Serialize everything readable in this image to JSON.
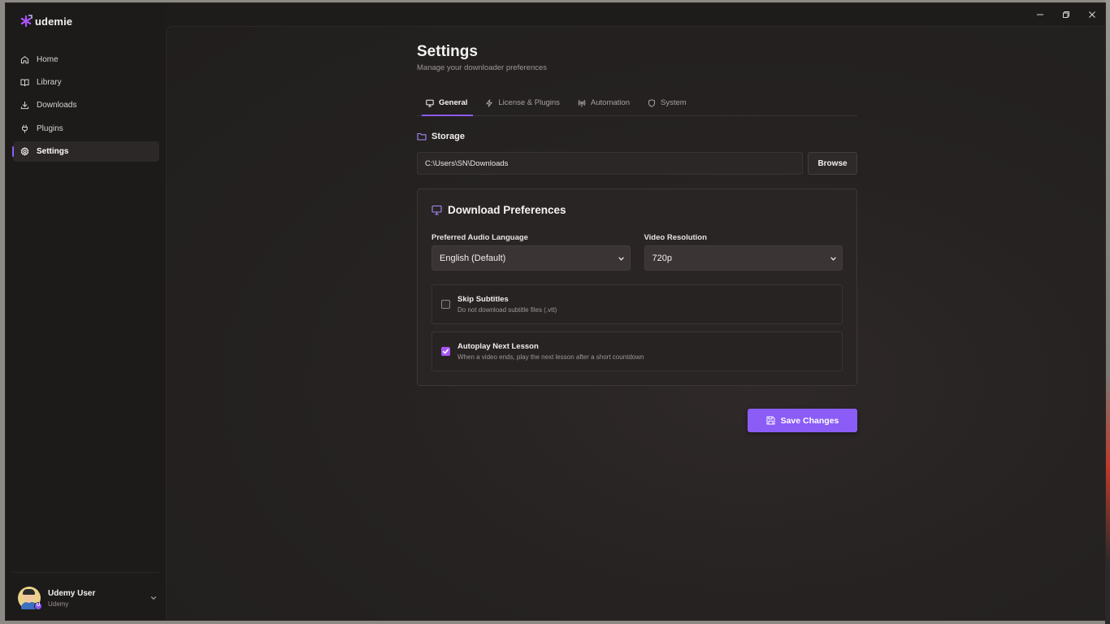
{
  "app": {
    "brand": "udemie"
  },
  "window_controls": {
    "minimize": "─",
    "restore": "❐",
    "close": "✕"
  },
  "sidebar": {
    "items": [
      {
        "label": "Home",
        "icon": "home-icon",
        "active": false
      },
      {
        "label": "Library",
        "icon": "book-icon",
        "active": false
      },
      {
        "label": "Downloads",
        "icon": "download-icon",
        "active": false
      },
      {
        "label": "Plugins",
        "icon": "plug-icon",
        "active": false
      },
      {
        "label": "Settings",
        "icon": "gear-icon",
        "active": true
      }
    ],
    "user": {
      "name": "Udemy User",
      "subtitle": "Udemy",
      "badge": "U"
    }
  },
  "page": {
    "title": "Settings",
    "subtitle": "Manage your downloader preferences"
  },
  "tabs": [
    {
      "label": "General",
      "icon": "monitor-icon",
      "active": true
    },
    {
      "label": "License & Plugins",
      "icon": "zap-icon",
      "active": false
    },
    {
      "label": "Automation",
      "icon": "broadcast-icon",
      "active": false
    },
    {
      "label": "System",
      "icon": "shield-icon",
      "active": false
    }
  ],
  "storage": {
    "heading": "Storage",
    "path": "C:\\Users\\SN\\Downloads",
    "browse_label": "Browse"
  },
  "download_preferences": {
    "heading": "Download Preferences",
    "audio_language": {
      "label": "Preferred Audio Language",
      "value": "English (Default)"
    },
    "video_resolution": {
      "label": "Video Resolution",
      "value": "720p"
    },
    "skip_subtitles": {
      "title": "Skip Subtitles",
      "description": "Do not download subtitle files (.vtt)",
      "checked": false
    },
    "autoplay_next": {
      "title": "Autoplay Next Lesson",
      "description": "When a video ends, play the next lesson after a short countdown",
      "checked": true
    }
  },
  "actions": {
    "save_label": "Save Changes"
  },
  "colors": {
    "accent": "#8b5cf6",
    "checkbox_accent": "#a855f7",
    "background": "#1e1b1b"
  }
}
